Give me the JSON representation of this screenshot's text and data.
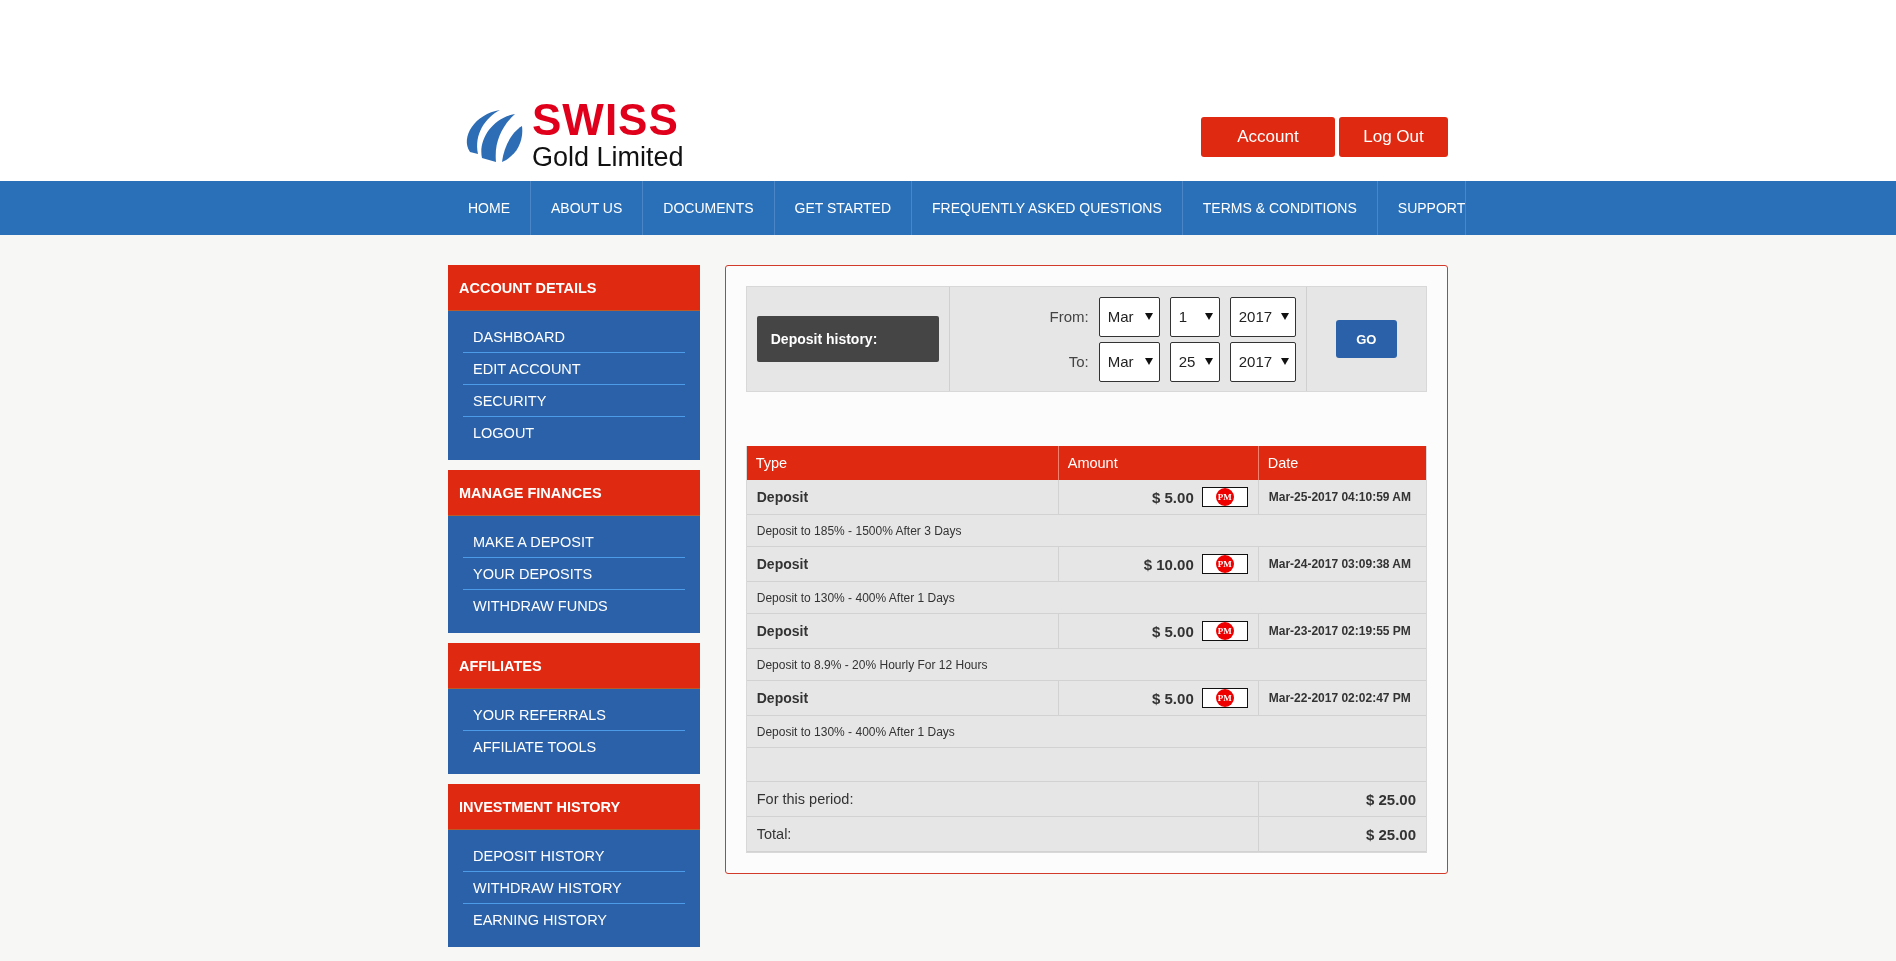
{
  "header": {
    "logo": {
      "brand": "SWISS",
      "tagline": "Gold Limited"
    },
    "buttons": [
      "Account",
      "Log Out"
    ]
  },
  "nav": {
    "items": [
      "HOME",
      "ABOUT US",
      "DOCUMENTS",
      "GET STARTED",
      "FREQUENTLY ASKED QUESTIONS",
      "TERMS & CONDITIONS",
      "SUPPORT"
    ]
  },
  "sidebar": {
    "sections": [
      {
        "title": "ACCOUNT DETAILS",
        "items": [
          "DASHBOARD",
          "EDIT ACCOUNT",
          "SECURITY",
          "LOGOUT"
        ]
      },
      {
        "title": "MANAGE FINANCES",
        "items": [
          "MAKE A DEPOSIT",
          "YOUR DEPOSITS",
          "WITHDRAW FUNDS"
        ]
      },
      {
        "title": "AFFILIATES",
        "items": [
          "YOUR REFERRALS",
          "AFFILIATE TOOLS"
        ]
      },
      {
        "title": "INVESTMENT HISTORY",
        "items": [
          "DEPOSIT HISTORY",
          "WITHDRAW HISTORY",
          "EARNING HISTORY"
        ]
      }
    ]
  },
  "filter": {
    "title": "Deposit history:",
    "ranges": [
      {
        "label": "From:",
        "month": "Mar",
        "day": "1",
        "year": "2017"
      },
      {
        "label": "To:",
        "month": "Mar",
        "day": "25",
        "year": "2017"
      }
    ],
    "go": "GO"
  },
  "table": {
    "columns": [
      "Type",
      "Amount",
      "Date"
    ],
    "rows": [
      {
        "type": "Deposit",
        "amount": "$ 5.00",
        "method": "PM",
        "date": "Mar-25-2017 04:10:59 AM",
        "plan": "Deposit to 185% - 1500% After 3 Days"
      },
      {
        "type": "Deposit",
        "amount": "$ 10.00",
        "method": "PM",
        "date": "Mar-24-2017 03:09:38 AM",
        "plan": "Deposit to 130% - 400% After 1 Days"
      },
      {
        "type": "Deposit",
        "amount": "$ 5.00",
        "method": "PM",
        "date": "Mar-23-2017 02:19:55 PM",
        "plan": "Deposit to 8.9% - 20% Hourly For 12 Hours"
      },
      {
        "type": "Deposit",
        "amount": "$ 5.00",
        "method": "PM",
        "date": "Mar-22-2017 02:02:47 PM",
        "plan": "Deposit to 130% - 400% After 1 Days"
      }
    ],
    "totals": [
      {
        "label": "For this period:",
        "value": "$ 25.00"
      },
      {
        "label": "Total:",
        "value": "$ 25.00"
      }
    ]
  }
}
